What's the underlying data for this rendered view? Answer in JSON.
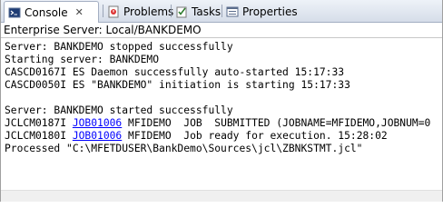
{
  "tabs": [
    {
      "label": "Console",
      "icon": "console-icon",
      "active": true
    },
    {
      "label": "Problems",
      "icon": "problems-icon"
    },
    {
      "label": "Tasks",
      "icon": "tasks-icon"
    },
    {
      "label": "Properties",
      "icon": "properties-icon"
    }
  ],
  "header": {
    "title": "Enterprise Server: Local/BANKDEMO"
  },
  "console": {
    "lines": [
      {
        "text": "Server: BANKDEMO stopped successfully"
      },
      {
        "text": "Starting server: BANKDEMO"
      },
      {
        "text": "CASCD0167I ES Daemon successfully auto-started 15:17:33"
      },
      {
        "text": "CASCD0050I ES \"BANKDEMO\" initiation is starting 15:17:33"
      },
      {
        "text": ""
      },
      {
        "text": "Server: BANKDEMO started successfully"
      },
      {
        "prefix": "JCLCM0187I ",
        "link": "JOB01006",
        "suffix": " MFIDEMO  JOB  SUBMITTED (JOBNAME=MFIDEMO,JOBNUM=0"
      },
      {
        "prefix": "JCLCM0180I ",
        "link": "JOB01006",
        "suffix": " MFIDEMO  Job ready for execution. 15:28:02"
      },
      {
        "text": "Processed \"C:\\MFETDUSER\\BankDemo\\Sources\\jcl\\ZBNKSTMT.jcl\""
      }
    ]
  }
}
